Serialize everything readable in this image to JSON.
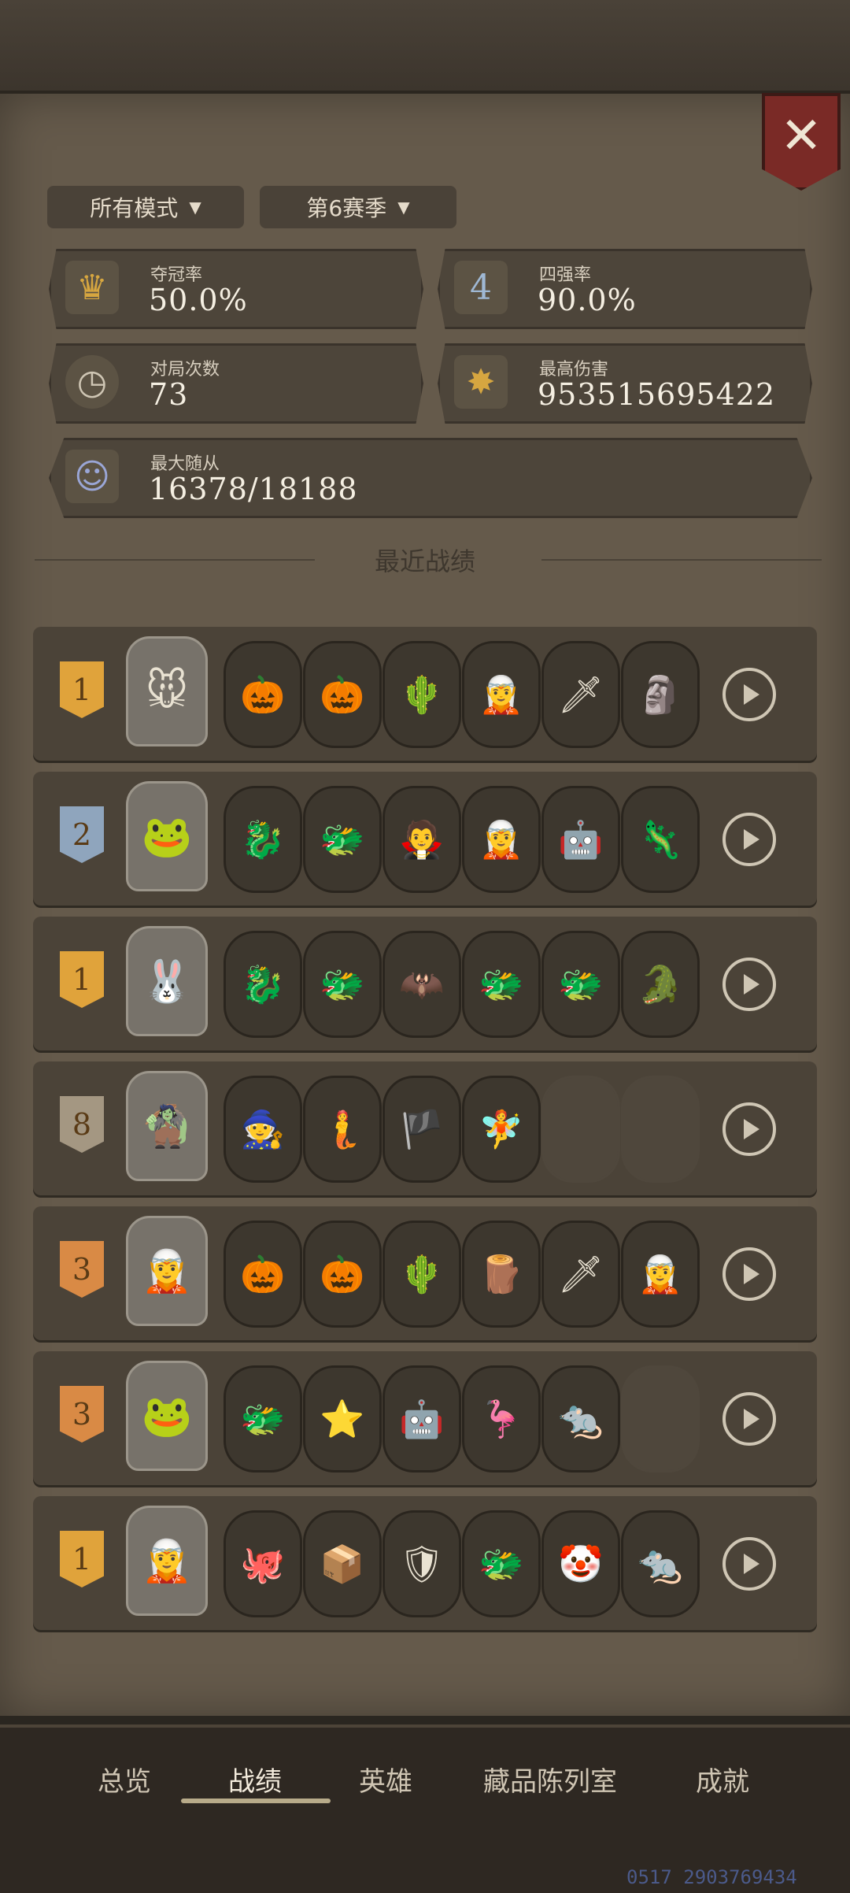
{
  "close": {
    "label": "✕"
  },
  "filters": {
    "mode": {
      "label": "所有模式"
    },
    "season": {
      "label": "第6赛季"
    }
  },
  "stats": {
    "win_rate": {
      "label": "夺冠率",
      "value": "50.0%",
      "icon": "crown-icon"
    },
    "top4_rate": {
      "label": "四强率",
      "value": "90.0%",
      "icon": "rank-4-badge-icon"
    },
    "matches": {
      "label": "对局次数",
      "value": "73",
      "icon": "clock-icon"
    },
    "max_damage": {
      "label": "最高伤害",
      "value": "953515695422",
      "icon": "damage-burst-icon"
    },
    "max_minion": {
      "label": "最大随从",
      "value": "16378/18188",
      "icon": "portrait-icon"
    }
  },
  "section": {
    "title": "最近战绩"
  },
  "matches": [
    {
      "rank": "1",
      "rank_color": "#e0a33b",
      "hero": "🐭",
      "minions": [
        "🎃",
        "🎃",
        "🌵",
        "🧝",
        "🗡",
        "🗿"
      ]
    },
    {
      "rank": "2",
      "rank_color": "#8fa5bd",
      "hero": "🐸",
      "minions": [
        "🐉",
        "🐲",
        "🧛",
        "🧝",
        "🤖",
        "🦎"
      ]
    },
    {
      "rank": "1",
      "rank_color": "#e0a33b",
      "hero": "🐰",
      "minions": [
        "🐉",
        "🐲",
        "🦇",
        "🐲",
        "🐲",
        "🐊"
      ]
    },
    {
      "rank": "8",
      "rank_color": "#a49782",
      "hero": "🧌",
      "minions": [
        "🧙",
        "🧜",
        "🏴",
        "🧚",
        "",
        ""
      ]
    },
    {
      "rank": "3",
      "rank_color": "#d98a45",
      "hero": "🧝",
      "minions": [
        "🎃",
        "🎃",
        "🌵",
        "🪵",
        "🗡",
        "🧝"
      ]
    },
    {
      "rank": "3",
      "rank_color": "#d98a45",
      "hero": "🐸",
      "minions": [
        "🐲",
        "⭐",
        "🤖",
        "🦩",
        "🐀",
        ""
      ]
    },
    {
      "rank": "1",
      "rank_color": "#e0a33b",
      "hero": "🧝",
      "minions": [
        "🐙",
        "📦",
        "🛡",
        "🐲",
        "🤡",
        "🐀"
      ]
    }
  ],
  "tabs": {
    "overview": "总览",
    "record": "战绩",
    "heroes": "英雄",
    "collection": "藏品陈列室",
    "achievements": "成就"
  },
  "watermark": "0517 2903769434"
}
